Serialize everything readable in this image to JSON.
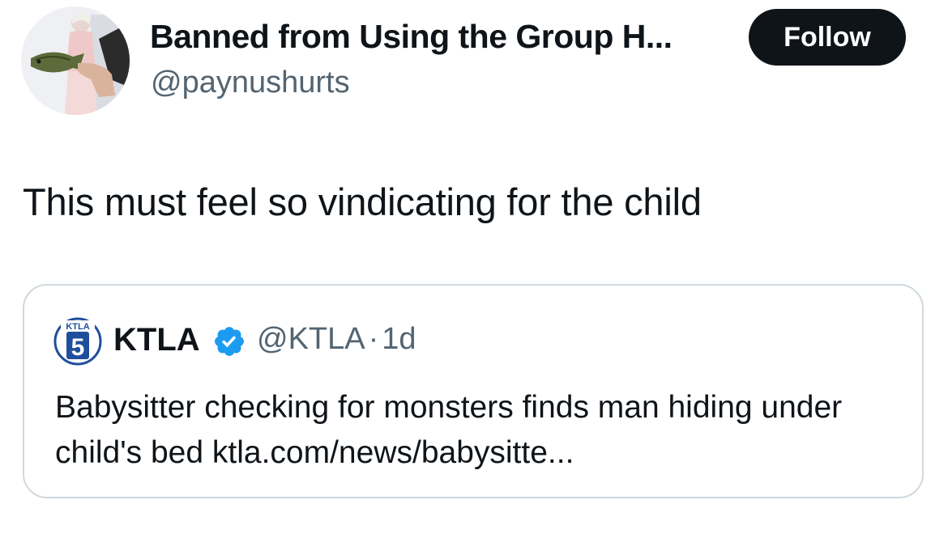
{
  "tweet": {
    "author": {
      "display_name": "Banned from Using the Group H...",
      "handle": "@paynushurts",
      "avatar_icon": "profile-photo-doll-holding-fish"
    },
    "follow_label": "Follow",
    "text": "This must feel so vindicating for the child"
  },
  "quote": {
    "logo_icon": "ktla-5-logo",
    "logo_text": "KTLA",
    "logo_number": "5",
    "name": "KTLA",
    "verified_icon": "verified-badge-icon",
    "handle": "@KTLA",
    "separator": "·",
    "time": "1d",
    "text": "Babysitter checking for monsters finds man hiding under child's bed ktla.com/news/babysitte..."
  },
  "colors": {
    "text_primary": "#0f1419",
    "text_secondary": "#536471",
    "border": "#cfd9de",
    "follow_bg": "#0f1419",
    "verified_blue": "#1d9bf0",
    "ktla_blue": "#1f4e9c"
  }
}
